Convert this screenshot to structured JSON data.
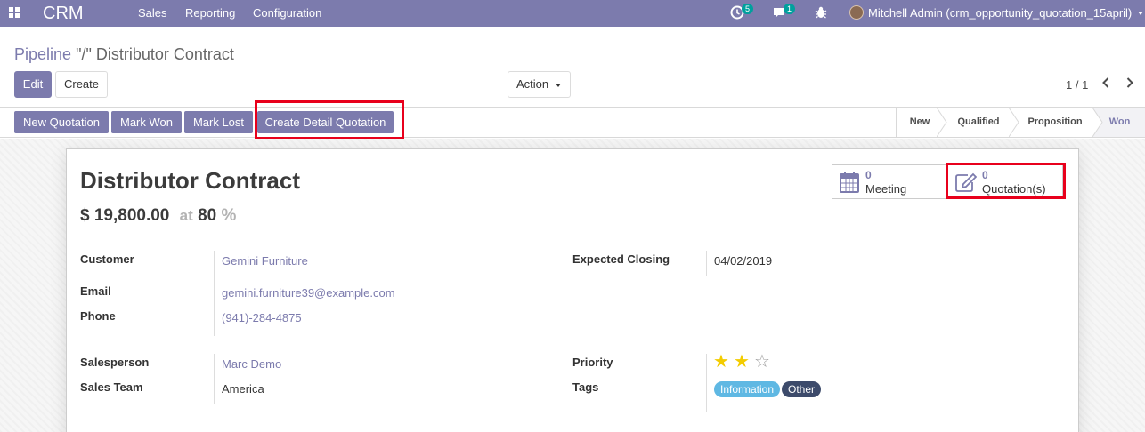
{
  "navbar": {
    "brand": "CRM",
    "menu": [
      "Sales",
      "Reporting",
      "Configuration"
    ],
    "activity_count": "5",
    "message_count": "1",
    "user": "Mitchell Admin (crm_opportunity_quotation_15april)"
  },
  "control_panel": {
    "breadcrumb_parent": "Pipeline",
    "breadcrumb_current": "\"/\" Distributor Contract",
    "edit_label": "Edit",
    "create_label": "Create",
    "action_label": "Action",
    "pager": "1 / 1"
  },
  "header_buttons": {
    "new_quotation": "New Quotation",
    "mark_won": "Mark Won",
    "mark_lost": "Mark Lost",
    "create_detail_quotation": "Create Detail Quotation"
  },
  "stages": [
    "New",
    "Qualified",
    "Proposition",
    "Won"
  ],
  "active_stage": "Won",
  "record": {
    "title": "Distributor Contract",
    "revenue": "$ 19,800.00",
    "at_label": "at",
    "probability": "80",
    "percent_sign": "%"
  },
  "smart_buttons": {
    "meeting_count": "0",
    "meeting_label": "Meeting",
    "quotation_count": "0",
    "quotation_label": "Quotation(s)"
  },
  "fields": {
    "customer_label": "Customer",
    "customer": "Gemini Furniture",
    "email_label": "Email",
    "email": "gemini.furniture39@example.com",
    "phone_label": "Phone",
    "phone": "(941)-284-4875",
    "expected_closing_label": "Expected Closing",
    "expected_closing": "04/02/2019",
    "salesperson_label": "Salesperson",
    "salesperson": "Marc Demo",
    "sales_team_label": "Sales Team",
    "sales_team": "America",
    "priority_label": "Priority",
    "priority": 2,
    "priority_max": 3,
    "tags_label": "Tags",
    "tags": [
      "Information",
      "Other"
    ]
  },
  "colors": {
    "brand": "#7c7bad",
    "highlight": "#e8001c",
    "star_filled": "#f3cc00",
    "tag_information": "#5fb8e3",
    "tag_other": "#3d4b6b"
  }
}
